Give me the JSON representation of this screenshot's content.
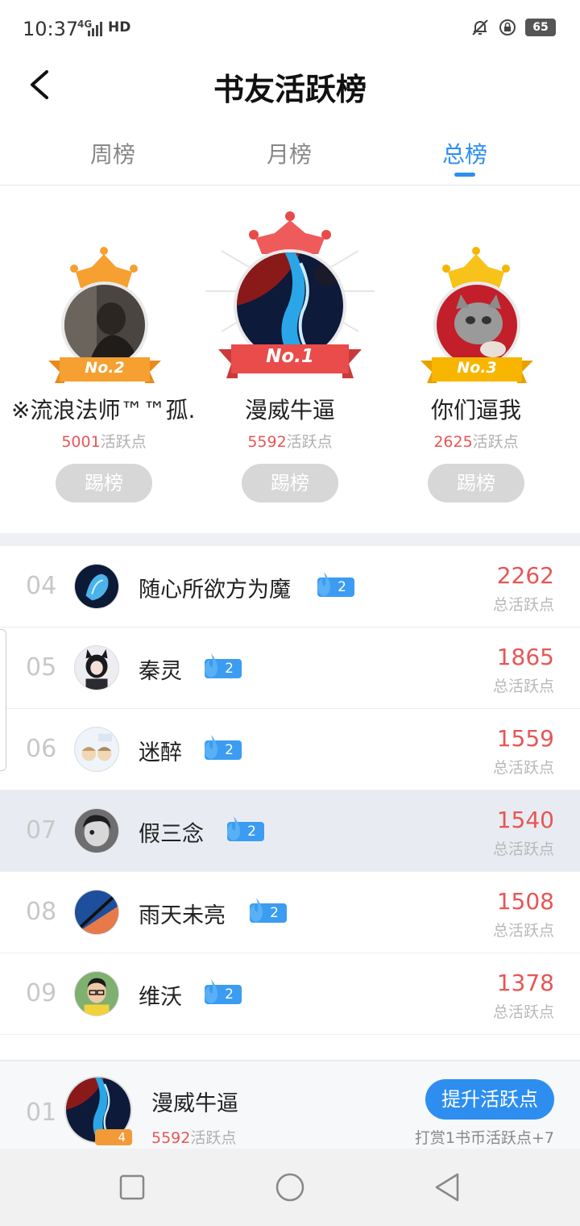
{
  "status_bar": {
    "time": "10:37",
    "network": "4G",
    "hd": "HD",
    "battery": "65"
  },
  "header": {
    "title": "书友活跃榜"
  },
  "tabs": [
    {
      "label": "周榜",
      "active": false
    },
    {
      "label": "月榜",
      "active": false
    },
    {
      "label": "总榜",
      "active": true
    }
  ],
  "podium": {
    "first": {
      "badge": "No.1",
      "name": "漫威牛逼",
      "points": "5592",
      "points_unit": "活跃点",
      "button": "踢榜"
    },
    "second": {
      "badge": "No.2",
      "name": "※流浪法师™™孤...",
      "points": "5001",
      "points_unit": "活跃点",
      "button": "踢榜"
    },
    "third": {
      "badge": "No.3",
      "name": "你们逼我",
      "points": "2625",
      "points_unit": "活跃点",
      "button": "踢榜"
    }
  },
  "list": [
    {
      "rank": "04",
      "name": "随心所欲方为魔",
      "level": "2",
      "score": "2262",
      "score_label": "总活跃点"
    },
    {
      "rank": "05",
      "name": "秦灵",
      "level": "2",
      "score": "1865",
      "score_label": "总活跃点"
    },
    {
      "rank": "06",
      "name": "迷醉",
      "level": "2",
      "score": "1559",
      "score_label": "总活跃点"
    },
    {
      "rank": "07",
      "name": "假三念",
      "level": "2",
      "score": "1540",
      "score_label": "总活跃点"
    },
    {
      "rank": "08",
      "name": "雨天未亮",
      "level": "2",
      "score": "1508",
      "score_label": "总活跃点"
    },
    {
      "rank": "09",
      "name": "维沃",
      "level": "2",
      "score": "1378",
      "score_label": "总活跃点"
    }
  ],
  "self": {
    "rank": "01",
    "name": "漫威牛逼",
    "level": "4",
    "points": "5592",
    "points_unit": "活跃点",
    "boost_button": "提升活跃点",
    "tip": "打赏1书币活跃点+7"
  },
  "colors": {
    "accent": "#2d8ef0",
    "score": "#e85555",
    "gold": "#f5b400",
    "first_red": "#e84a4a",
    "second_orange": "#f5a030"
  }
}
